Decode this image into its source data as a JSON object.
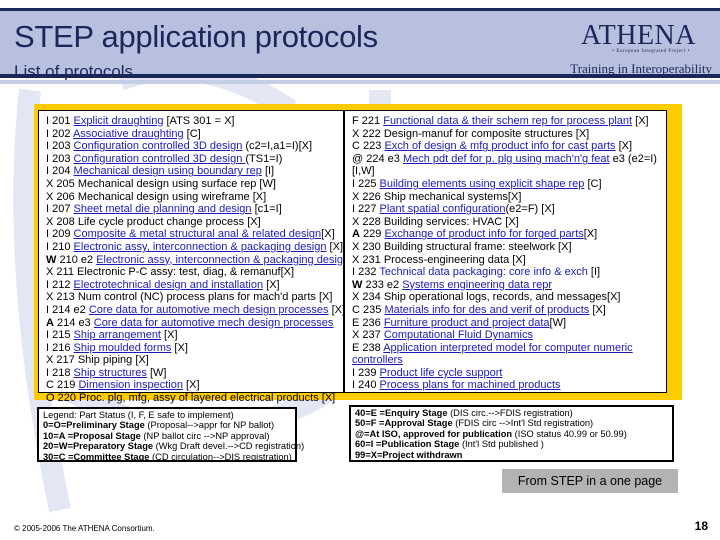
{
  "header": {
    "title": "STEP application protocols",
    "subtitle": "List of protocols",
    "logo": {
      "name": "ATHENA",
      "tagline": "• European Integrated Project •",
      "subtitle": "Training in Interoperability"
    }
  },
  "protocols": {
    "left": [
      {
        "status": "I",
        "code": "201",
        "edition": "",
        "link": "Explicit draughting",
        "suffix": " [ATS 301 = X]"
      },
      {
        "status": "I",
        "code": "202",
        "edition": "",
        "link": "Associative draughting",
        "suffix": " [C]"
      },
      {
        "status": "I",
        "code": "203",
        "edition": "",
        "link": "Configuration controlled 3D design",
        "suffix": " (c2=I,a1=I)[X]"
      },
      {
        "status": "I",
        "code": "203",
        "edition": "",
        "link": "Configuration controlled 3D design ",
        "suffix": "(TS1=I)"
      },
      {
        "status": "I",
        "code": "204",
        "edition": "",
        "link": "Mechanical design using boundary rep",
        "suffix": " [I]"
      },
      {
        "status": "X",
        "code": "205",
        "edition": "",
        "link": "",
        "suffix": "Mechanical design using surface rep [W]"
      },
      {
        "status": "X",
        "code": "206",
        "edition": "",
        "link": "",
        "suffix": "Mechanical design using wireframe [X]"
      },
      {
        "status": "I",
        "code": "207",
        "edition": "",
        "link": "Sheet metal die planning and design",
        "suffix": " [c1=I]"
      },
      {
        "status": "X",
        "code": "208",
        "edition": "",
        "link": "",
        "suffix": "Life cycle product change process [X]"
      },
      {
        "status": "I",
        "code": "209",
        "edition": "",
        "link": "Composite & metal structural anal & related design",
        "suffix": "[X]"
      },
      {
        "status": "I",
        "code": "210",
        "edition": "",
        "link": "Electronic assy, interconnection & packaging design",
        "suffix": " [X]"
      },
      {
        "status": "W",
        "code": "210",
        "edition": "e2",
        "link": "Electronic assy, interconnection & packaging design",
        "suffix": "",
        "bold_status": true
      },
      {
        "status": "X",
        "code": "211",
        "edition": "",
        "link": "",
        "suffix": "Electronic P-C assy: test, diag, & remanuf[X]"
      },
      {
        "status": "I",
        "code": "212",
        "edition": "",
        "link": "Electrotechnical design and installation",
        "suffix": " [X]"
      },
      {
        "status": "X",
        "code": "213",
        "edition": "",
        "link": "",
        "suffix": "Num control (NC) process plans for mach'd parts [X]"
      },
      {
        "status": "I",
        "code": "214",
        "edition": "e2",
        "link": "Core data for automotive mech design processes",
        "suffix": "  [X]"
      },
      {
        "status": "A",
        "code": "214",
        "edition": "e3",
        "link": "Core data for automotive mech design processes",
        "suffix": "",
        "bold_status": true
      },
      {
        "status": "I",
        "code": "215",
        "edition": "",
        "link": "Ship arrangement",
        "suffix": " [X]"
      },
      {
        "status": "I",
        "code": "216",
        "edition": "",
        "link": "Ship moulded forms",
        "suffix": " [X]"
      },
      {
        "status": "X",
        "code": "217",
        "edition": "",
        "link": "",
        "suffix": "Ship piping [X]"
      },
      {
        "status": "I",
        "code": "218",
        "edition": "",
        "link": "Ship structures",
        "suffix": " [W]"
      },
      {
        "status": "C",
        "code": "219",
        "edition": "",
        "link": "Dimension inspection",
        "suffix": " [X]"
      },
      {
        "status": "O",
        "code": "220",
        "edition": "",
        "link": "",
        "suffix": "Proc. plg, mfg, assy of layered electrical products [X]"
      }
    ],
    "right": [
      {
        "status": "F",
        "code": "221",
        "edition": "",
        "link": "Functional data & their schem rep for process plant",
        "suffix": " [X]"
      },
      {
        "status": "X",
        "code": "222",
        "edition": "",
        "link": "",
        "suffix": "Design-manuf for composite structures [X]"
      },
      {
        "status": "C",
        "code": "223",
        "edition": "",
        "link": "Exch of design & mfg product info for cast parts",
        "suffix": " [X]"
      },
      {
        "status": "@",
        "code": "224",
        "edition": "e3",
        "link": "Mech pdt def for p. plg using mach'n'g feat",
        "suffix": " e3 (e2=I)"
      },
      {
        "status": "",
        "code": "",
        "edition": "",
        "link": "",
        "suffix": "[I,W]",
        "continuation": true
      },
      {
        "status": "I",
        "code": "225",
        "edition": "",
        "link": "Building elements using explicit shape rep",
        "suffix": " [C]"
      },
      {
        "status": "X",
        "code": "226",
        "edition": "",
        "link": "",
        "suffix": "Ship mechanical systems[X]"
      },
      {
        "status": "I",
        "code": "227",
        "edition": "",
        "link": "Plant spatial configuration",
        "suffix": "(e2=F) [X]"
      },
      {
        "status": "X",
        "code": "228",
        "edition": "",
        "link": "",
        "suffix": "Building services: HVAC [X]"
      },
      {
        "status": "A",
        "code": "229",
        "edition": "",
        "link": "Exchange of product info for forged parts",
        "suffix": "[X]",
        "bold_status": true
      },
      {
        "status": "X",
        "code": "230",
        "edition": "",
        "link": "",
        "suffix": "Building structural frame: steelwork [X]"
      },
      {
        "status": "X",
        "code": "231",
        "edition": "",
        "link": "",
        "suffix": "Process-engineering data [X]"
      },
      {
        "status": "I",
        "code": "232",
        "edition": "",
        "link": "",
        "blue_text": "Technical data packaging: core info & exch",
        "suffix": " [I]"
      },
      {
        "status": "W",
        "code": "233",
        "edition": "e2",
        "link": "Systems engineering data repr",
        "suffix": "",
        "bold_status": true
      },
      {
        "status": "X",
        "code": "234",
        "edition": "",
        "link": "",
        "suffix": "Ship operational logs, records, and messages[X]"
      },
      {
        "status": "C",
        "code": "235",
        "edition": "",
        "link": "Materials info for des and verif of products",
        "suffix": " [X]"
      },
      {
        "status": "E",
        "code": "236",
        "edition": "",
        "link": "Furniture product and project data",
        "suffix": "[W]"
      },
      {
        "status": "X",
        "code": "237",
        "edition": "",
        "link": "Computational Fluid Dynamics",
        "suffix": ""
      },
      {
        "status": "E",
        "code": "238",
        "edition": "",
        "link": "Application interpreted model for computer numeric ",
        "suffix": ""
      },
      {
        "status": "",
        "code": "",
        "edition": "",
        "link": "controllers",
        "suffix": "",
        "continuation": true
      },
      {
        "status": "I",
        "code": "239",
        "edition": "",
        "link": "Product life cycle support",
        "suffix": ""
      },
      {
        "status": "I",
        "code": "240",
        "edition": "",
        "link": "Process plans for machined products",
        "suffix": ""
      }
    ]
  },
  "legend": {
    "left": [
      {
        "bold": "",
        "text": "Legend: Part Status (I, F, E safe to implement)"
      },
      {
        "bold": "0=O=Preliminary Stage",
        "text": " (Proposal-->appr for NP ballot)"
      },
      {
        "bold": "10=A =Proposal Stage",
        "text": " (NP ballot circ -->NP approval)"
      },
      {
        "bold": "20=W=Preparatory Stage",
        "text": " (Wkg Draft devel.-->CD registration)"
      },
      {
        "bold": "30=C =Committee Stage",
        "text": " (CD circulation-->DIS registration)"
      }
    ],
    "right": [
      {
        "bold": "40=E =Enquiry Stage",
        "text": " (DIS circ.-->FDIS registration)"
      },
      {
        "bold": "50=F =Approval Stage",
        "text": " (FDIS circ -->Int'l Std registration)"
      },
      {
        "bold": "@=At ISO, approved for publication",
        "text": " (ISO status 40.99 or 50.99)"
      },
      {
        "bold": "60=I =Publication Stage",
        "text": " (Int'l Std published )"
      },
      {
        "bold": "99=X=Project withdrawn",
        "text": ""
      }
    ]
  },
  "caption": "From STEP in a one page",
  "footer": {
    "copyright": "© 2005-2006 The ATHENA Consortium.",
    "page_number": "18"
  },
  "colors": {
    "header_band": "#b7c0df",
    "header_text": "#1c2759",
    "frame": "#ffcc00",
    "link": "#1d1ab8",
    "caption_bg": "#b3b3b3"
  }
}
